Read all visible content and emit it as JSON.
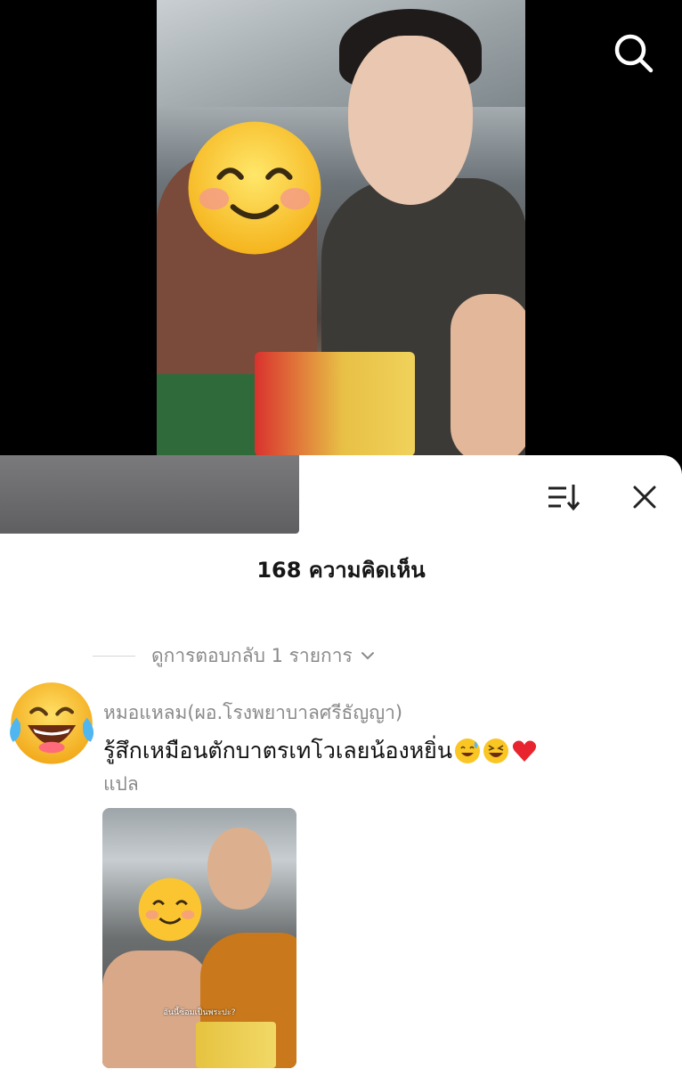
{
  "top_bar": {
    "search_icon": "search-icon"
  },
  "video": {
    "watermark_icon": "smiling-face-emoji"
  },
  "comments_panel": {
    "count_label": "168 ความคิดเห็น",
    "sort_icon": "sort-icon",
    "close_icon": "close-icon"
  },
  "thread": {
    "view_replies_label": "ดูการตอบกลับ 1 รายการ",
    "comment": {
      "username": "หมอแหลม(ผอ.โรงพยาบาลศรีธัญญา)",
      "text": "รู้สึกเหมือนตักบาตรเทโวเลยน้องหยิ่น",
      "emojis": [
        "sweat-smile-emoji",
        "laughing-emoji",
        "red-heart-emoji"
      ],
      "translate_label": "แปล",
      "avatar_icon": "tears-of-joy-emoji",
      "attachment_caption": "อันนี้ซ้อมเป็นพระปะ?"
    }
  },
  "colors": {
    "panel_bg": "#ffffff",
    "secondary_text": "#8a8a8a",
    "primary_text": "#111111",
    "heart": "#e8242f"
  }
}
